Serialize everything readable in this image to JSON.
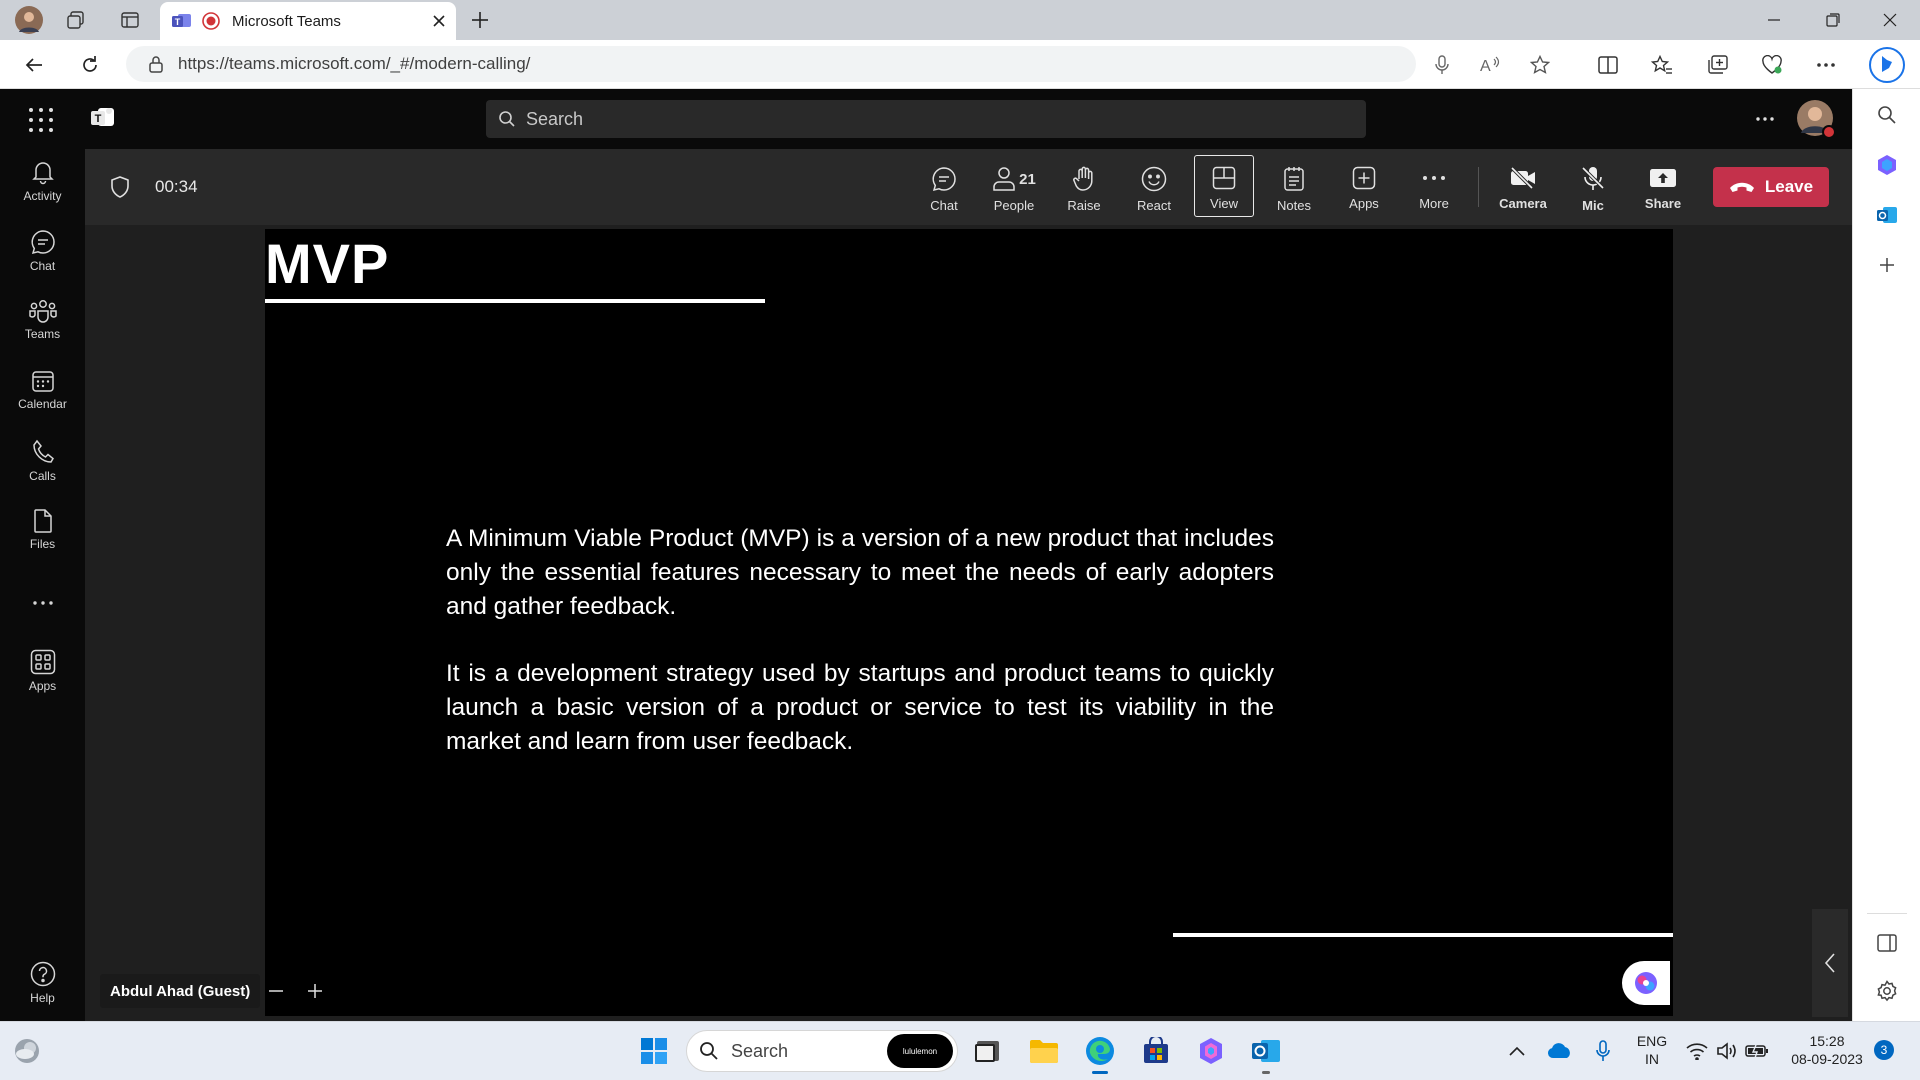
{
  "browser": {
    "tab_title": "Microsoft Teams",
    "url": "https://teams.microsoft.com/_#/modern-calling/"
  },
  "teams": {
    "search_placeholder": "Search",
    "rail": [
      {
        "label": "Activity",
        "icon": "bell-icon"
      },
      {
        "label": "Chat",
        "icon": "chat-icon"
      },
      {
        "label": "Teams",
        "icon": "teams-icon"
      },
      {
        "label": "Calendar",
        "icon": "calendar-icon"
      },
      {
        "label": "Calls",
        "icon": "phone-icon"
      },
      {
        "label": "Files",
        "icon": "file-icon"
      },
      {
        "label": "Apps",
        "icon": "apps-icon"
      },
      {
        "label": "Help",
        "icon": "help-icon"
      }
    ]
  },
  "meeting": {
    "timer": "00:34",
    "controls": {
      "chat": "Chat",
      "people": "People",
      "people_count": "21",
      "raise": "Raise",
      "react": "React",
      "view": "View",
      "notes": "Notes",
      "apps": "Apps",
      "more": "More",
      "camera": "Camera",
      "mic": "Mic",
      "share": "Share",
      "leave": "Leave"
    },
    "presenter": "Abdul Ahad (Guest)",
    "slide": {
      "title": "MVP",
      "paragraph1": "A Minimum Viable Product (MVP) is a version of a new product that includes only the essential features necessary to meet the needs of early adopters and gather feedback.",
      "paragraph2": "It is a development strategy used by startups and product teams to quickly launch a basic version of a product or service to test its viability in the market and learn from user feedback."
    }
  },
  "taskbar": {
    "search_placeholder": "Search",
    "search_badge": "lululemon",
    "lang_top": "ENG",
    "lang_bottom": "IN",
    "time": "15:28",
    "date": "08-09-2023",
    "notification_count": "3"
  },
  "colors": {
    "leave_red": "#c4314b",
    "teams_purple": "#5b5fc7"
  }
}
